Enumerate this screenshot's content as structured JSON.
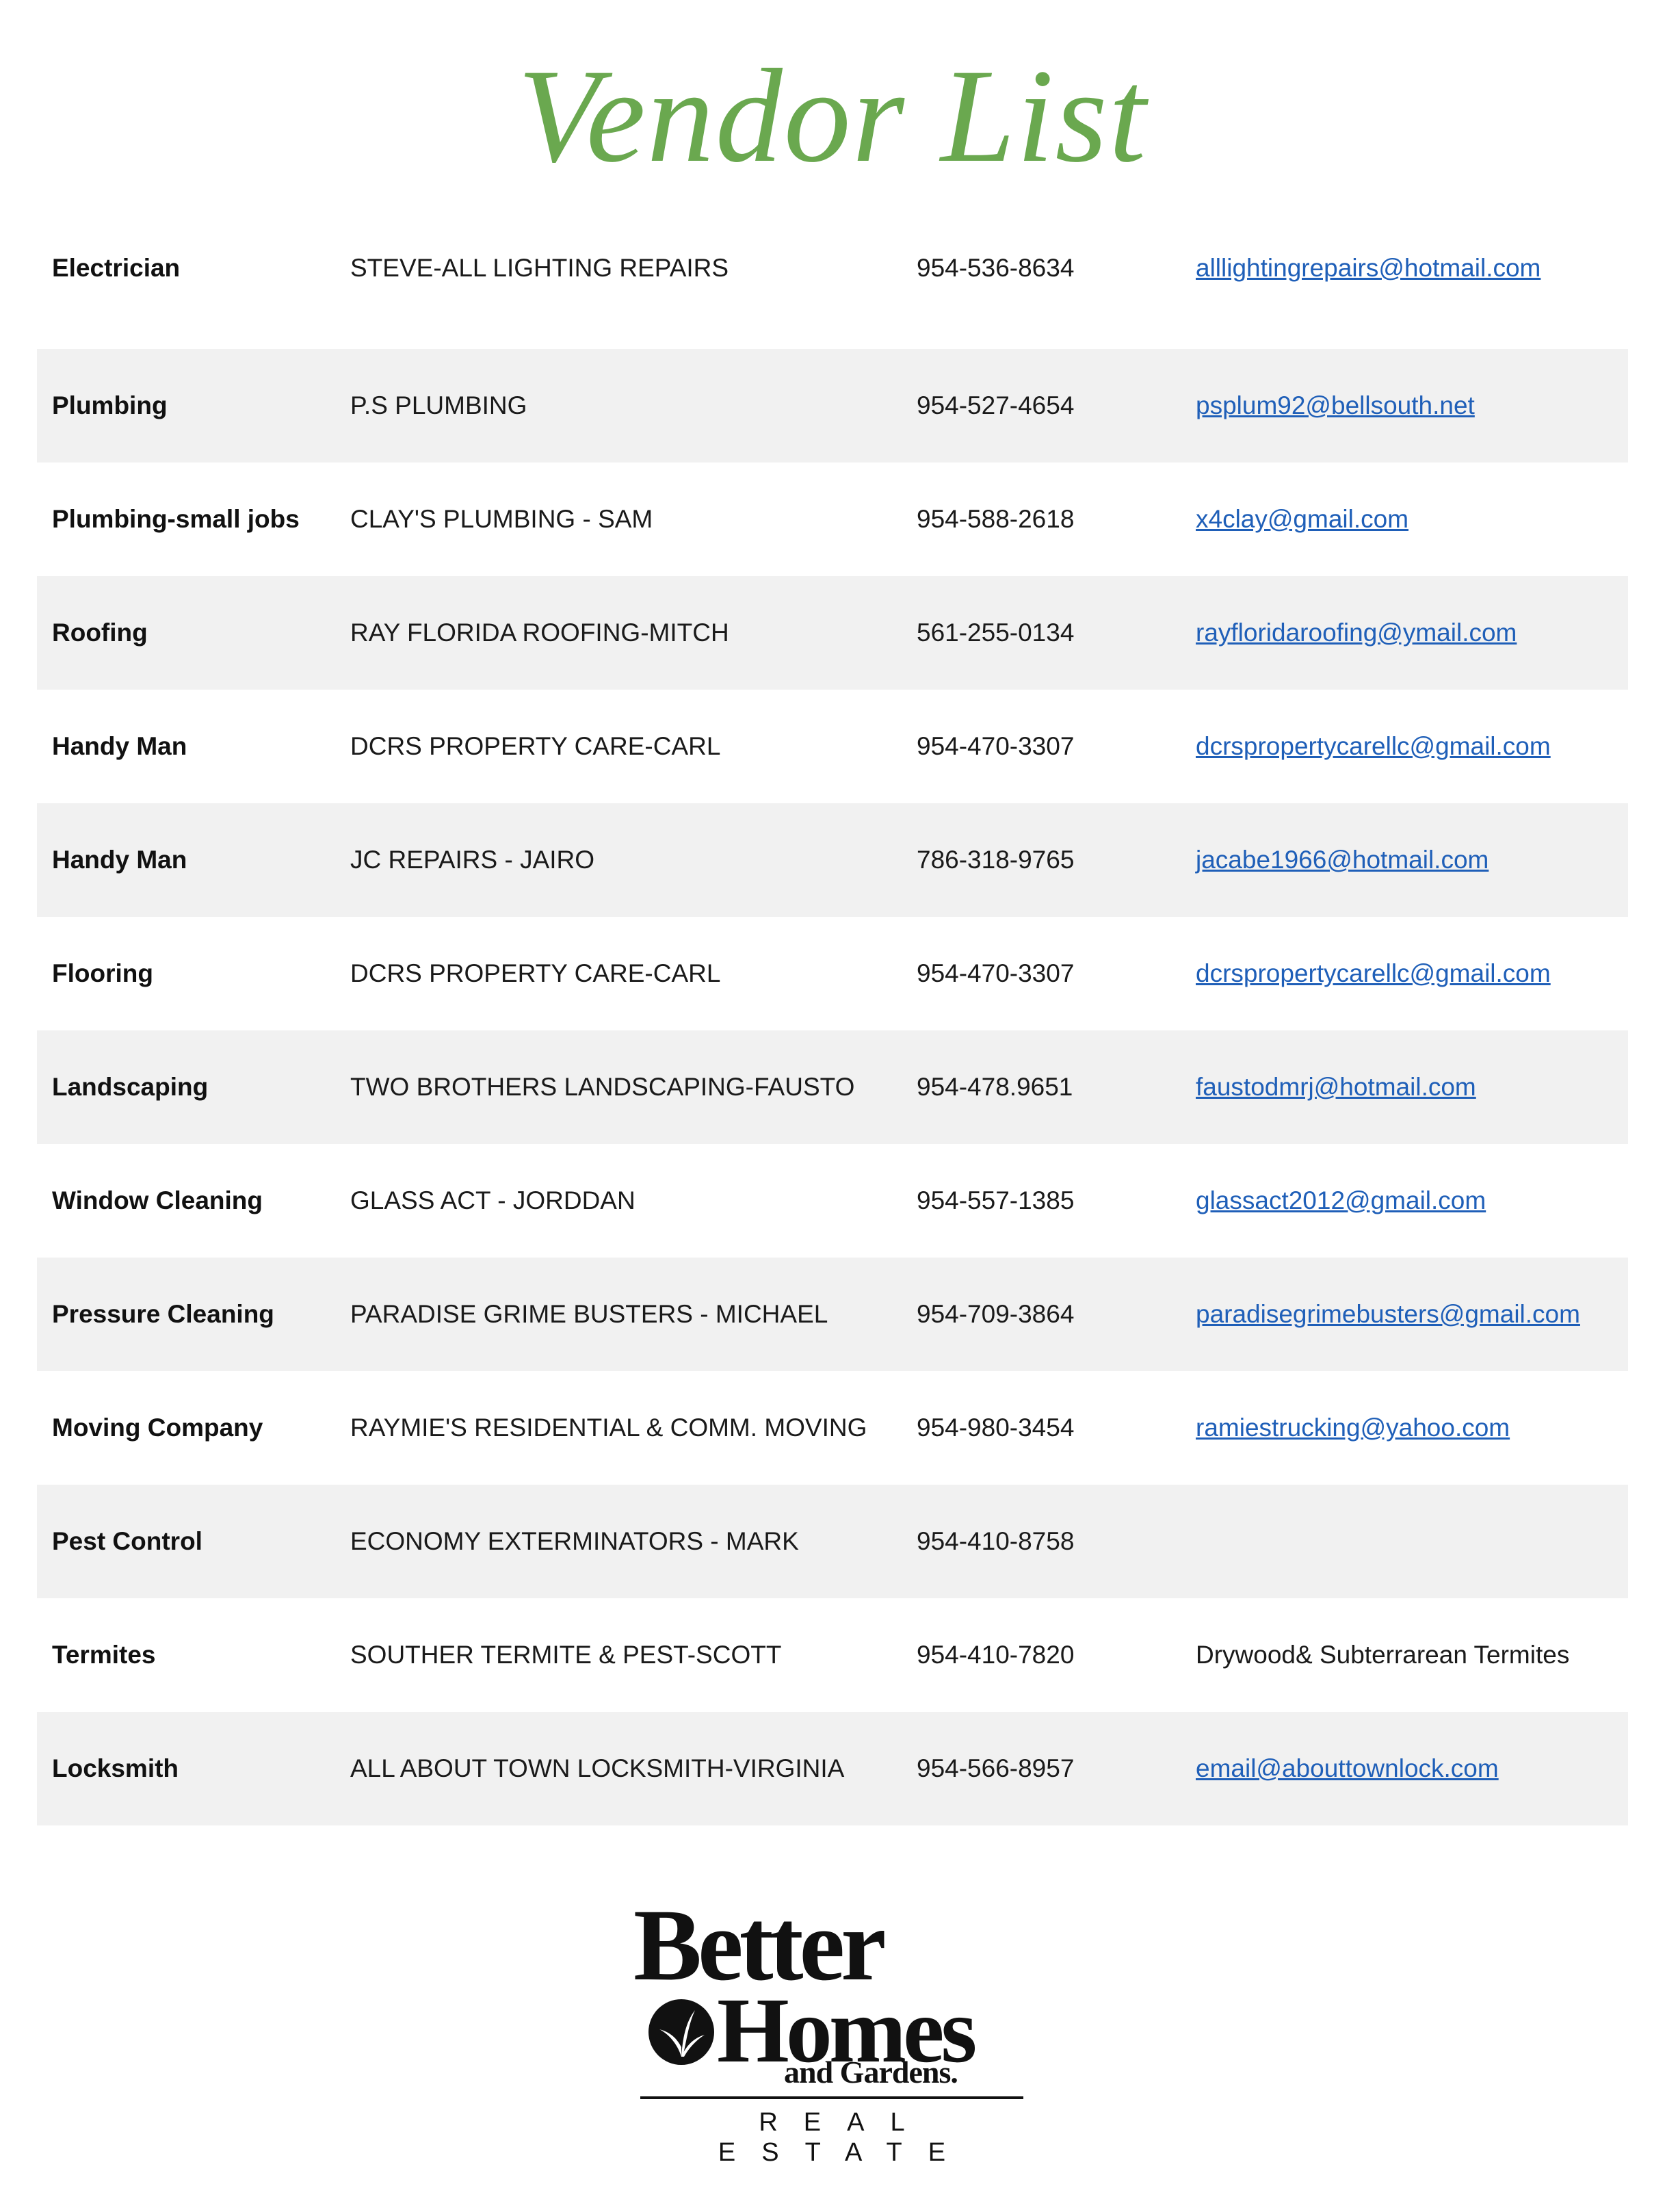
{
  "title": "Vendor List",
  "colors": {
    "title_green": "#6aa84f",
    "row_shade": "#f1f1f1",
    "link_blue": "#1f5fb8"
  },
  "vendors": [
    {
      "category": "Electrician",
      "vendor": "STEVE-ALL LIGHTING REPAIRS",
      "phone": "954-536-8634",
      "email": "alllightingrepairs@hotmail.com"
    },
    {
      "category": "Plumbing",
      "vendor": "P.S PLUMBING",
      "phone": "954-527-4654",
      "email": "psplum92@bellsouth.net"
    },
    {
      "category": "Plumbing-small jobs",
      "vendor": "CLAY'S PLUMBING - SAM",
      "phone": "954-588-2618",
      "email": "x4clay@gmail.com"
    },
    {
      "category": "Roofing",
      "vendor": "RAY FLORIDA ROOFING-MITCH",
      "phone": "561-255-0134",
      "email": "rayfloridaroofing@ymail.com"
    },
    {
      "category": "Handy Man",
      "vendor": "DCRS PROPERTY CARE-CARL",
      "phone": "954-470-3307",
      "email": "dcrspropertycarellc@gmail.com"
    },
    {
      "category": "Handy Man",
      "vendor": "JC REPAIRS - JAIRO",
      "phone": "786-318-9765",
      "email": "jacabe1966@hotmail.com"
    },
    {
      "category": "Flooring",
      "vendor": "DCRS PROPERTY CARE-CARL",
      "phone": "954-470-3307",
      "email": "dcrspropertycarellc@gmail.com"
    },
    {
      "category": "Landscaping",
      "vendor": "TWO BROTHERS LANDSCAPING-FAUSTO",
      "phone": "954-478.9651",
      "email": "faustodmrj@hotmail.com"
    },
    {
      "category": "Window Cleaning",
      "vendor": "GLASS ACT - JORDDAN",
      "phone": "954-557-1385",
      "email": "glassact2012@gmail.com"
    },
    {
      "category": "Pressure Cleaning",
      "vendor": "PARADISE GRIME BUSTERS - MICHAEL",
      "phone": "954-709-3864",
      "email": "paradisegrimebusters@gmail.com"
    },
    {
      "category": "Moving Company",
      "vendor": "RAYMIE'S RESIDENTIAL & COMM. MOVING",
      "phone": "954-980-3454",
      "email": "ramiestrucking@yahoo.com"
    },
    {
      "category": "Pest Control",
      "vendor": "ECONOMY EXTERMINATORS - MARK",
      "phone": "954-410-8758",
      "email": ""
    },
    {
      "category": "Termites",
      "vendor": "SOUTHER TERMITE & PEST-SCOTT",
      "phone": "954-410-7820",
      "note": "Drywood& Subterrarean Termites"
    },
    {
      "category": "Locksmith",
      "vendor": "ALL ABOUT TOWN LOCKSMITH-VIRGINIA",
      "phone": "954-566-8957",
      "email": "email@abouttownlock.com"
    }
  ],
  "logo": {
    "line1": "Better",
    "line2": "Homes",
    "line3": "and Gardens.",
    "tagline": "REAL ESTATE",
    "mark_icon": "leaf-emblem-icon"
  }
}
